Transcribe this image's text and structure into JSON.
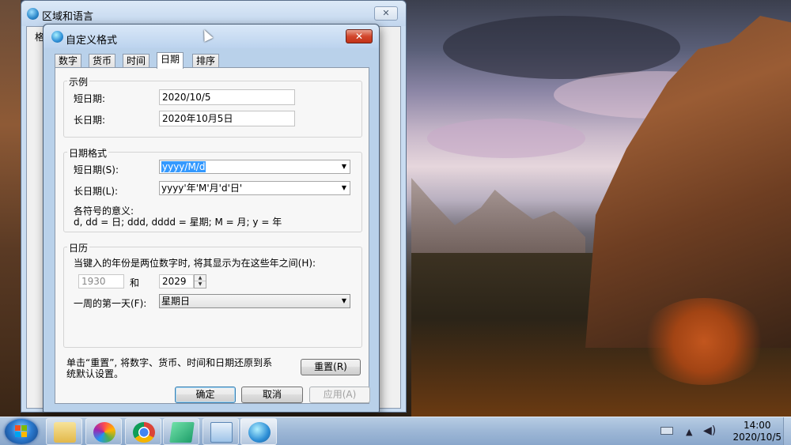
{
  "bg_dialog": {
    "title": "区域和语言",
    "tab_partial": "格",
    "icon": "globe-icon"
  },
  "dialog": {
    "title": "自定义格式",
    "icon": "globe-icon",
    "close_label": "✕",
    "tabs": [
      {
        "label": "数字",
        "active": false
      },
      {
        "label": "货币",
        "active": false
      },
      {
        "label": "时间",
        "active": false
      },
      {
        "label": "日期",
        "active": true
      },
      {
        "label": "排序",
        "active": false
      }
    ],
    "example": {
      "group_label": "示例",
      "short_label": "短日期:",
      "short_value": "2020/10/5",
      "long_label": "长日期:",
      "long_value": "2020年10月5日"
    },
    "format": {
      "group_label": "日期格式",
      "short_label": "短日期(S):",
      "short_value": "yyyy/M/d",
      "long_label": "长日期(L):",
      "long_value": "yyyy'年'M'月'd'日'",
      "meaning_title": "各符号的意义:",
      "meaning_text": "d, dd = 日;  ddd, dddd = 星期;  M = 月;  y = 年"
    },
    "calendar": {
      "group_label": "日历",
      "two_digit_text": "当键入的年份是两位数字时, 将其显示为在这些年之间(H):",
      "year_from": "1930",
      "and_label": "和",
      "year_to": "2029",
      "first_day_label": "一周的第一天(F):",
      "first_day_value": "星期日"
    },
    "reset": {
      "text_line1": "单击“重置”, 将数字、货币、时间和日期还原到系",
      "text_line2": "统默认设置。",
      "button_label": "重置(R)"
    },
    "buttons": {
      "ok": "确定",
      "cancel": "取消",
      "apply": "应用(A)"
    }
  },
  "taskbar": {
    "items": [
      "file-explorer-icon",
      "pinwheel-app-icon",
      "chrome-icon",
      "notebook-icon",
      "control-panel-icon",
      "region-language-icon"
    ],
    "clock_time": "14:00",
    "clock_date": "2020/10/5"
  }
}
